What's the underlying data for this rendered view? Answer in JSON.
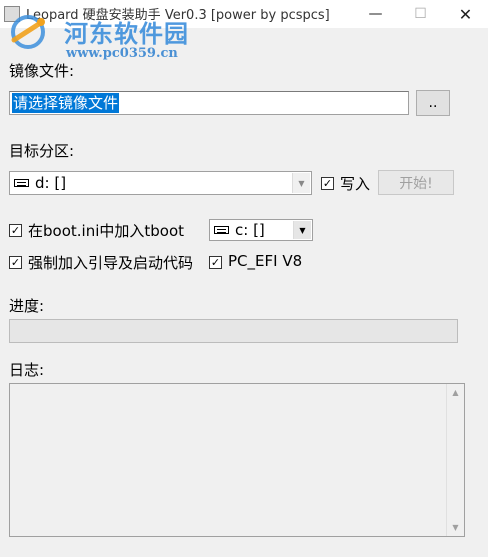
{
  "window": {
    "title": "Leopard 硬盘安装助手 Ver0.3 [power by pcspcs]",
    "minimize": "—",
    "maximize": "☐",
    "close": "✕"
  },
  "watermark": {
    "site_name": "河东软件园",
    "url": "www.pc0359.cn"
  },
  "image_file": {
    "label": "镜像文件:",
    "value": "请选择镜像文件",
    "browse_label": ".."
  },
  "target_partition": {
    "label": "目标分区:",
    "selected": "d: []",
    "write_checkbox": {
      "checked": true,
      "label": "写入"
    },
    "start_button": "开始!"
  },
  "boot_ini": {
    "checked": true,
    "label": "在boot.ini中加入tboot",
    "drive_selected": "c: []"
  },
  "options": {
    "force_boot_code": {
      "checked": true,
      "label": "强制加入引导及启动代码"
    },
    "pc_efi": {
      "checked": true,
      "label": "PC_EFI V8"
    }
  },
  "progress": {
    "label": "进度:",
    "value": 0
  },
  "log": {
    "label": "日志:",
    "content": ""
  },
  "icons": {
    "check_mark": "✓",
    "dropdown_arrow": "▼",
    "scroll_up": "▲",
    "scroll_down": "▼"
  },
  "colors": {
    "selection": "#0078d7",
    "watermark": "#3d8fdc",
    "progress_fill": "#06b025"
  }
}
